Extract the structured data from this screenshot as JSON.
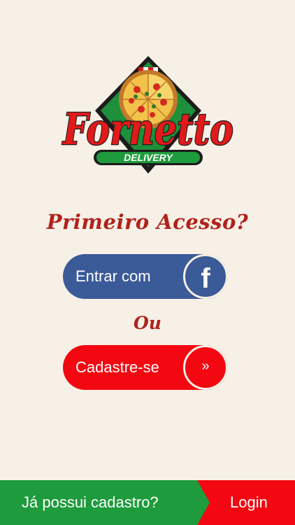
{
  "logo": {
    "brand": "Fornetto",
    "tagline": "DELIVERY"
  },
  "headline": "Primeiro Acesso?",
  "facebook_button": {
    "label": "Entrar com",
    "icon": "facebook-icon",
    "icon_glyph": "f"
  },
  "separator": "Ou",
  "register_button": {
    "label": "Cadastre-se",
    "icon": "double-chevron-right-icon",
    "icon_glyph": "»"
  },
  "footer": {
    "prompt": "Já possui cadastro?",
    "login_label": "Login"
  },
  "colors": {
    "background": "#f6f0e6",
    "brand_red": "#f30711",
    "headline_red": "#b0231c",
    "facebook_blue": "#3b5a98",
    "green": "#1e9b3c"
  }
}
